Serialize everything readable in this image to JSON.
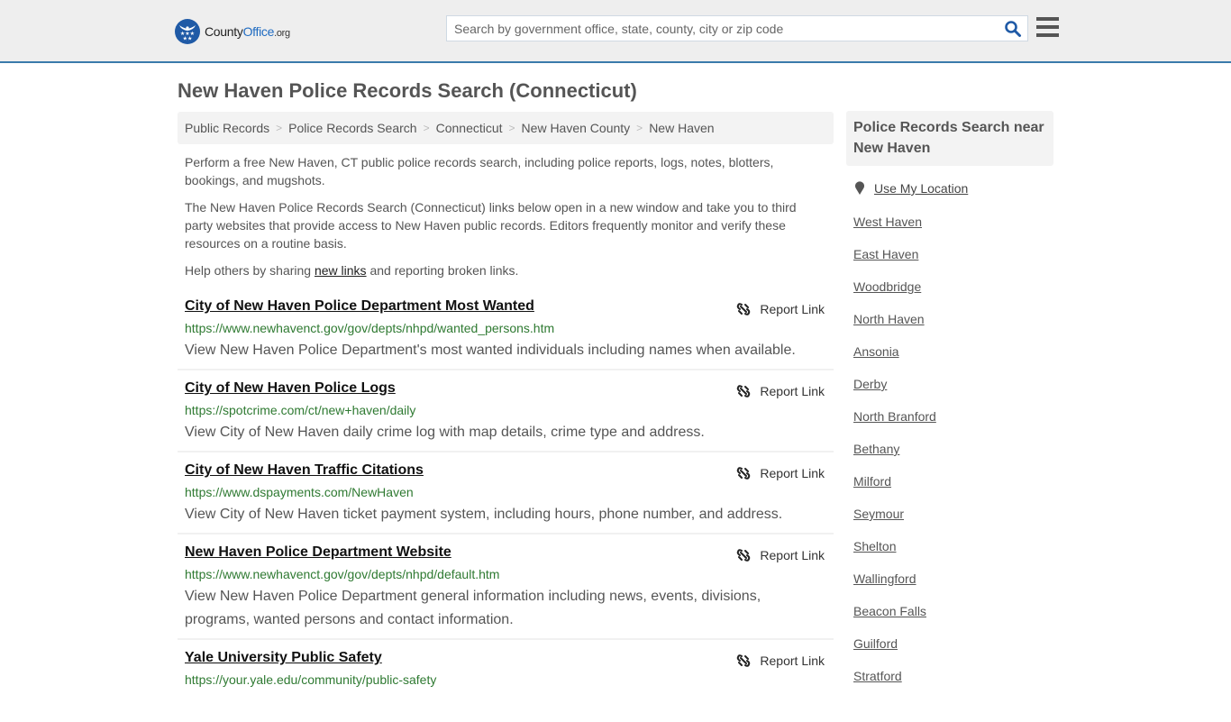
{
  "header": {
    "logo": {
      "county": "County",
      "office": "Office",
      "org": ".org"
    },
    "search": {
      "placeholder": "Search by government office, state, county, city or zip code",
      "value": ""
    },
    "colors": {
      "brand_blue": "#1f5aa6",
      "header_bg": "#eeeeee",
      "header_border": "#3a7bab"
    }
  },
  "page": {
    "title": "New Haven Police Records Search (Connecticut)",
    "breadcrumb": [
      "Public Records",
      "Police Records Search",
      "Connecticut",
      "New Haven County",
      "New Haven"
    ],
    "intro": {
      "p1": "Perform a free New Haven, CT public police records search, including police reports, logs, notes, blotters, bookings, and mugshots.",
      "p2": "The New Haven Police Records Search (Connecticut) links below open in a new window and take you to third party websites that provide access to New Haven public records. Editors frequently monitor and verify these resources on a routine basis.",
      "p3_before": "Help others by sharing ",
      "p3_link": "new links",
      "p3_after": " and reporting broken links."
    }
  },
  "results": [
    {
      "title": "City of New Haven Police Department Most Wanted",
      "url": "https://www.newhavenct.gov/gov/depts/nhpd/wanted_persons.htm",
      "desc": "View New Haven Police Department's most wanted individuals including names when available.",
      "report": "Report Link"
    },
    {
      "title": "City of New Haven Police Logs",
      "url": "https://spotcrime.com/ct/new+haven/daily",
      "desc": "View City of New Haven daily crime log with map details, crime type and address.",
      "report": "Report Link"
    },
    {
      "title": "City of New Haven Traffic Citations",
      "url": "https://www.dspayments.com/NewHaven",
      "desc": "View City of New Haven ticket payment system, including hours, phone number, and address.",
      "report": "Report Link"
    },
    {
      "title": "New Haven Police Department Website",
      "url": "https://www.newhavenct.gov/gov/depts/nhpd/default.htm",
      "desc": "View New Haven Police Department general information including news, events, divisions, programs, wanted persons and contact information.",
      "report": "Report Link"
    },
    {
      "title": "Yale University Public Safety",
      "url": "https://your.yale.edu/community/public-safety",
      "desc": "",
      "report": "Report Link"
    }
  ],
  "sidebar": {
    "heading": "Police Records Search near New Haven",
    "use_location": "Use My Location",
    "links": [
      "West Haven",
      "East Haven",
      "Woodbridge",
      "North Haven",
      "Ansonia",
      "Derby",
      "North Branford",
      "Bethany",
      "Milford",
      "Seymour",
      "Shelton",
      "Wallingford",
      "Beacon Falls",
      "Guilford",
      "Stratford"
    ]
  }
}
